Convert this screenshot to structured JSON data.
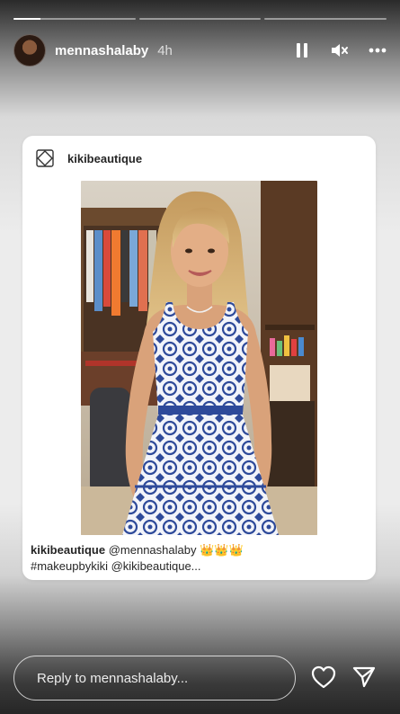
{
  "progress": {
    "segments": [
      {
        "filled": 0.22
      },
      {
        "filled": 0
      },
      {
        "filled": 0
      }
    ]
  },
  "header": {
    "username": "mennashalaby",
    "time": "4h"
  },
  "card": {
    "account": "kikibeautique",
    "caption": {
      "account": "kikibeautique",
      "text_line1": "@mennashalaby",
      "crowns": "👑👑👑",
      "text_line2": "#makeupbykiki @kikibeautique..."
    }
  },
  "reply": {
    "placeholder": "Reply to mennashalaby..."
  },
  "colors": {
    "story_gradient_top": "#2a2a2a",
    "card_bg": "#ffffff",
    "crown_gold": "#e8b92e"
  },
  "icons": [
    "pause-icon",
    "mute-icon",
    "more-icon",
    "brand-logo-icon",
    "heart-icon",
    "send-icon"
  ]
}
